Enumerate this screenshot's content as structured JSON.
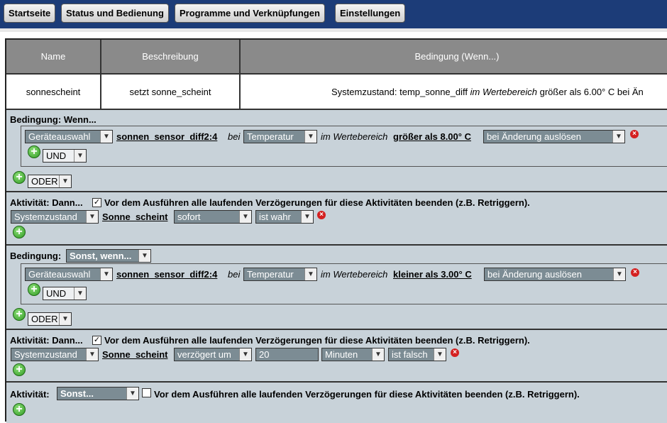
{
  "nav": {
    "startseite": "Startseite",
    "status": "Status und Bedienung",
    "programme": "Programme und Verknüpfungen",
    "einstellungen": "Einstellungen"
  },
  "table": {
    "headers": {
      "name": "Name",
      "beschreibung": "Beschreibung",
      "bedingung": "Bedingung (Wenn...)"
    },
    "row": {
      "name": "sonnescheint",
      "beschreibung": "setzt sonne_scheint",
      "bed_pre": "Systemzustand: temp_sonne_diff ",
      "bed_it": "im Wertebereich",
      "bed_post": " größer als 6.00° C bei Än"
    }
  },
  "cond1": {
    "label": "Bedingung: Wenn...",
    "device_select": "Geräteauswahl",
    "device": "sonnen_sensor_diff2:4",
    "bei": "bei",
    "param_select": "Temperatur",
    "im_wb": "im Wertebereich",
    "range": "größer als 8.00° C",
    "trigger_select": "bei Änderung auslösen",
    "und": "UND",
    "oder": "ODER"
  },
  "act1": {
    "label": "Aktivität: Dann...",
    "checked": "✓",
    "retrigger": "Vor dem Ausführen alle laufenden Verzögerungen für diese Aktivitäten beenden (z.B. Retriggern).",
    "type_select": "Systemzustand",
    "target": "Sonne_scheint",
    "timing_select": "sofort",
    "value_select": "ist wahr"
  },
  "cond2": {
    "label": "Bedingung:",
    "mode_select": "Sonst, wenn...",
    "device_select": "Geräteauswahl",
    "device": "sonnen_sensor_diff2:4",
    "bei": "bei",
    "param_select": "Temperatur",
    "im_wb": "im Wertebereich",
    "range": "kleiner als 3.00° C",
    "trigger_select": "bei Änderung auslösen",
    "und": "UND",
    "oder": "ODER"
  },
  "act2": {
    "label": "Aktivität: Dann...",
    "checked": "✓",
    "retrigger": "Vor dem Ausführen alle laufenden Verzögerungen für diese Aktivitäten beenden (z.B. Retriggern).",
    "type_select": "Systemzustand",
    "target": "Sonne_scheint",
    "timing_select": "verzögert um",
    "delay_value": "20",
    "unit_select": "Minuten",
    "value_select": "ist falsch"
  },
  "act3": {
    "label": "Aktivität:",
    "mode_select": "Sonst...",
    "retrigger": "Vor dem Ausführen alle laufenden Verzögerungen für diese Aktivitäten beenden (z.B. Retriggern)."
  },
  "icons": {
    "add": "+",
    "delete": "×",
    "dropdown": "▼"
  }
}
